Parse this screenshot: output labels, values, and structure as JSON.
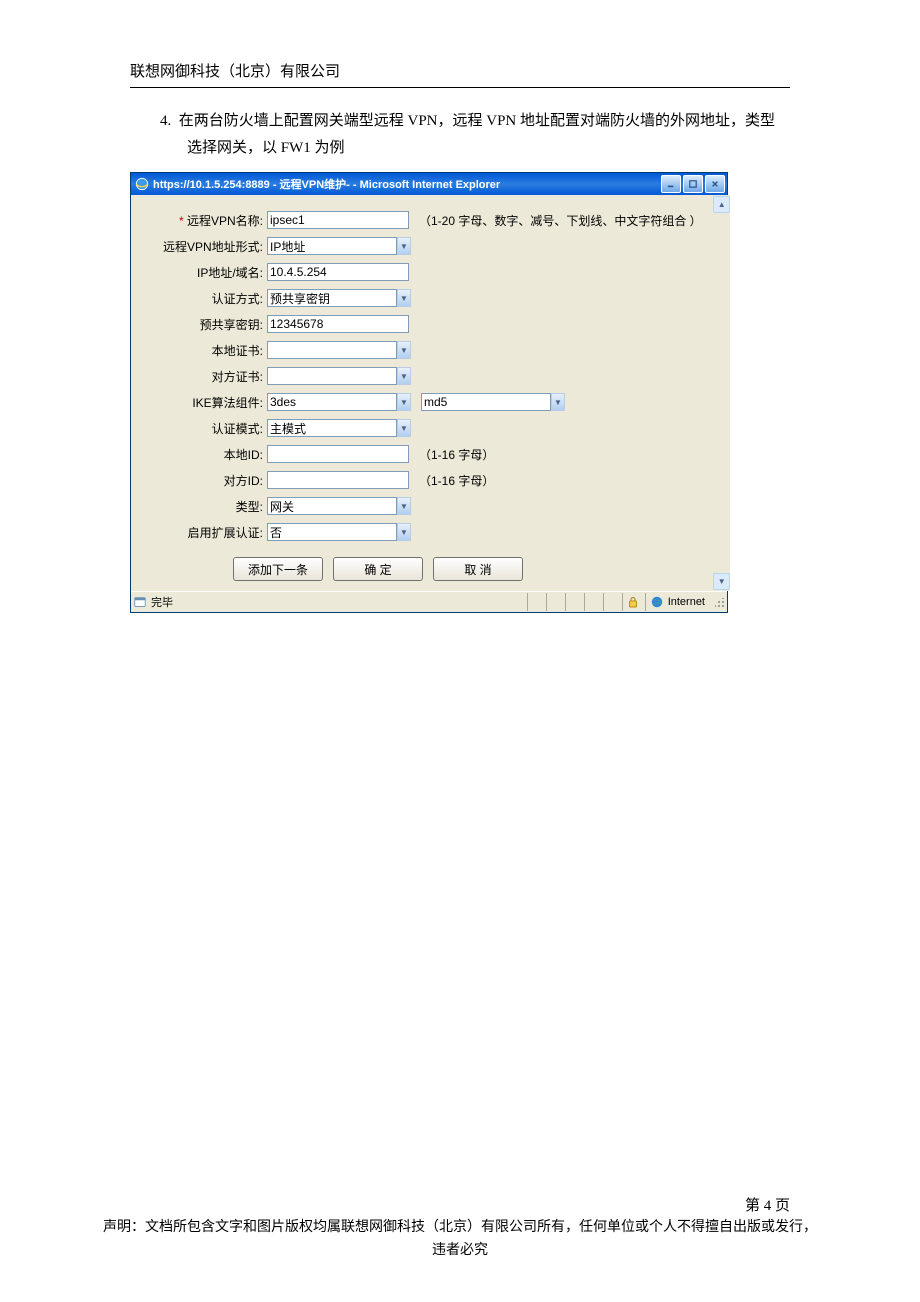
{
  "doc": {
    "header": "联想网御科技（北京）有限公司",
    "item_no": "4.",
    "para": "在两台防火墙上配置网关端型远程 VPN，远程 VPN 地址配置对端防火墙的外网地址，类型选择网关，以 FW1 为例",
    "page_num": "第 4 页",
    "disclaimer": "声明：文档所包含文字和图片版权均属联想网御科技（北京）有限公司所有，任何单位或个人不得擅自出版或发行，违者必究"
  },
  "win": {
    "title": "https://10.1.5.254:8889 - 远程VPN维护- - Microsoft Internet Explorer",
    "status_left": "完毕",
    "status_zone": "Internet"
  },
  "form": {
    "labels": {
      "name": "远程VPN名称:",
      "addr_type": "远程VPN地址形式:",
      "ip": "IP地址/域名:",
      "auth": "认证方式:",
      "psk": "预共享密钥:",
      "local_cert": "本地证书:",
      "peer_cert": "对方证书:",
      "ike": "IKE算法组件:",
      "auth_mode": "认证模式:",
      "local_id": "本地ID:",
      "peer_id": "对方ID:",
      "type": "类型:",
      "ext_auth": "启用扩展认证:"
    },
    "values": {
      "name": "ipsec1",
      "addr_type": "IP地址",
      "ip": "10.4.5.254",
      "auth": "预共享密钥",
      "psk": "12345678",
      "local_cert": "",
      "peer_cert": "",
      "ike_enc": "3des",
      "ike_hash": "md5",
      "auth_mode": "主模式",
      "local_id": "",
      "peer_id": "",
      "type": "网关",
      "ext_auth": "否"
    },
    "hints": {
      "name": "（1-20 字母、数字、减号、下划线、中文字符组合 ）",
      "local_id": "（1-16 字母）",
      "peer_id": "（1-16 字母）"
    },
    "buttons": {
      "add_next": "添加下一条",
      "ok": "确 定",
      "cancel": "取 消"
    }
  }
}
